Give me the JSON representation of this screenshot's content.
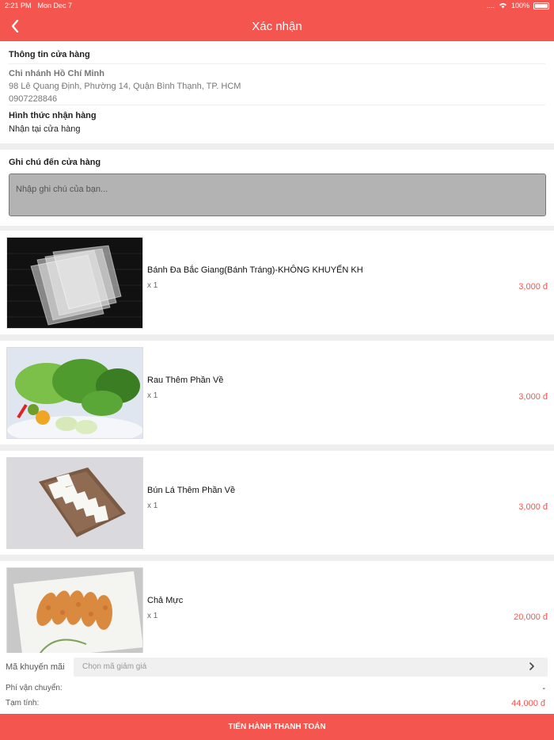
{
  "status_bar": {
    "time": "2:21 PM",
    "date": "Mon Dec 7",
    "signal": "....",
    "battery": "100%"
  },
  "header": {
    "title": "Xác nhận"
  },
  "store": {
    "section_title": "Thông tin cửa hàng",
    "branch_name": "Chi nhánh Hồ Chí Minh",
    "address": "98 Lê Quang Định, Phường 14, Quận Bình Thạnh, TP. HCM",
    "phone": "0907228846",
    "pickup_title": "Hình thức nhận hàng",
    "pickup_value": "Nhận tại cửa hàng"
  },
  "note": {
    "title": "Ghi chú đến cửa hàng",
    "placeholder": "Nhập ghi chú của bạn..."
  },
  "items": [
    {
      "name": "Bánh Đa Bắc Giang(Bánh Tráng)-KHÔNG KHUYẾN KH",
      "qty": "x 1",
      "price": "3,000 đ"
    },
    {
      "name": "Rau Thêm Phần Về",
      "qty": "x 1",
      "price": "3,000 đ"
    },
    {
      "name": "Bún Lá Thêm Phần Về",
      "qty": "x 1",
      "price": "3,000 đ"
    },
    {
      "name": "Chả Mực",
      "qty": "x 1",
      "price": "20,000 đ"
    }
  ],
  "summary": {
    "promo_label": "Mã khuyến mãi",
    "promo_placeholder": "Chọn mã giảm giá",
    "shipping_label": "Phí vận chuyển:",
    "shipping_value": "-",
    "subtotal_label": "Tạm tính:",
    "subtotal_value": "44,000 đ"
  },
  "cta": {
    "label": "TIẾN HÀNH THANH TOÁN"
  },
  "colors": {
    "accent": "#f5554f"
  }
}
